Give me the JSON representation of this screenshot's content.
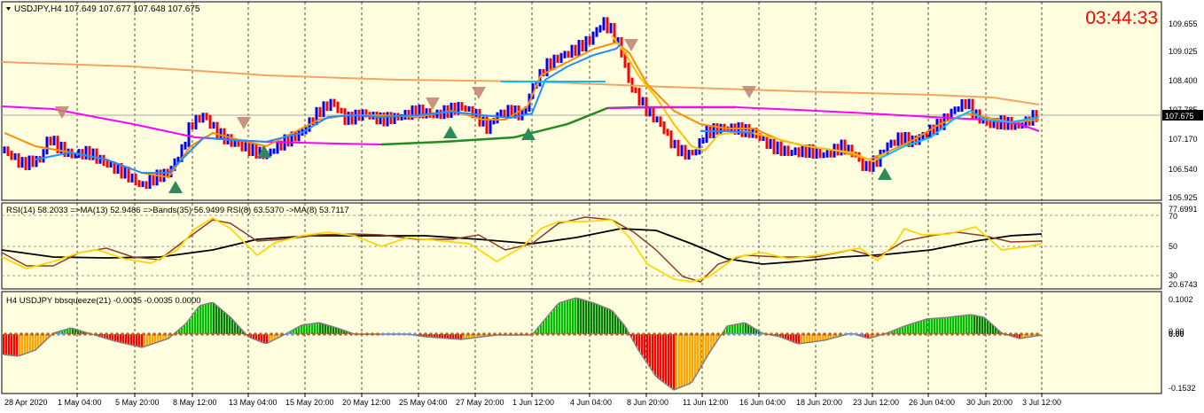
{
  "main_panel": {
    "header": "USDJPY,H4  107.649 107.677 107.648 107.675",
    "timer": "03:44:33",
    "current_price_label": "107.675",
    "price_labels": [
      "109.655",
      "109.025",
      "108.400",
      "107.785",
      "107.170",
      "106.540",
      "105.925"
    ]
  },
  "rsi_panel": {
    "header": "RSI(14) 58.2033  =>MA(13) 52.9486  =>Bands(35) 56.9499  RSI(8) 63.5370  ->MA(8) 53.7117",
    "labels": [
      "77.6991",
      "70",
      "50",
      "30",
      "20.6743"
    ]
  },
  "squeeze_panel": {
    "header": "H4 USDJPY bbsqueeze(21) -0.0035 -0.0035 0.0000",
    "labels": [
      "0.1002",
      "0.00",
      "0.00",
      "-0.1532"
    ]
  },
  "time_axis": [
    "28 Apr 2020",
    "1 May 04:00",
    "5 May 20:00",
    "8 May 12:00",
    "13 May 04:00",
    "15 May 20:00",
    "20 May 12:00",
    "25 May 04:00",
    "27 May 20:00",
    "1 Jun 12:00",
    "4 Jun 04:00",
    "8 Jun 20:00",
    "11 Jun 12:00",
    "16 Jun 04:00",
    "18 Jun 20:00",
    "23 Jun 12:00",
    "26 Jun 04:00",
    "30 Jun 20:00",
    "3 Jul 12:00"
  ],
  "colors": {
    "bull_bar": "#0000ff",
    "bear_bar": "#ff0000",
    "ma_slow": "#f4a460",
    "ma_magenta": "#ff00ff",
    "ma_green": "#228b22",
    "ma_orange": "#ff8c00",
    "ma_blue": "#1e90ff",
    "ma_gold": "#ffc000",
    "rsi_gold": "#ffd700",
    "rsi_brown": "#8b3a2a",
    "hist_green": "#00c000",
    "hist_red": "#ff0000",
    "hist_orange": "#ffa500",
    "timer": "#ff0000"
  }
}
